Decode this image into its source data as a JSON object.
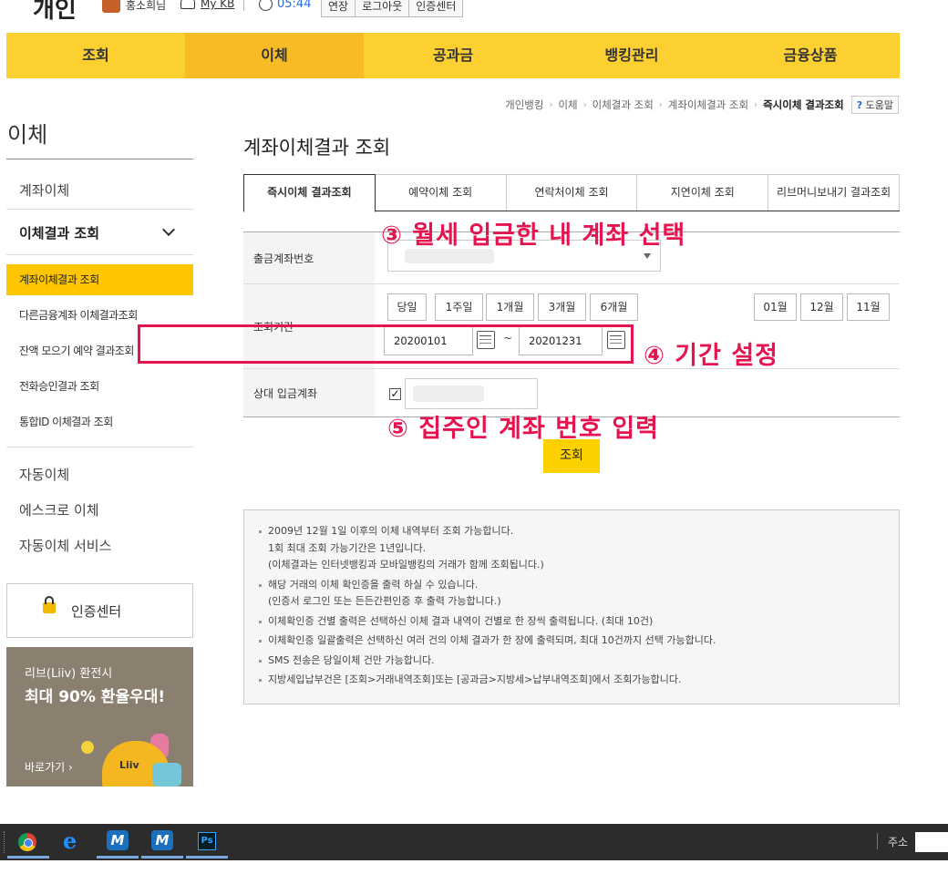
{
  "header": {
    "brand": "개인",
    "user_name": "홍소희님",
    "mykb_label": "My KB",
    "time": "05:44",
    "buttons": [
      "연장",
      "로그아웃",
      "인증센터"
    ]
  },
  "gnb": {
    "items": [
      "조회",
      "이체",
      "공과금",
      "뱅킹관리",
      "금융상품"
    ],
    "active_index": 1
  },
  "breadcrumb": {
    "items": [
      "개인뱅킹",
      "이체",
      "이체결과 조회",
      "계좌이체결과 조회"
    ],
    "current": "즉시이체 결과조회",
    "help_label": "도움말"
  },
  "sidebar": {
    "title": "이체",
    "items": [
      "계좌이체",
      "이체결과 조회",
      "자동이체",
      "에스크로 이체",
      "자동이체 서비스"
    ],
    "sub_items": [
      "계좌이체결과 조회",
      "다른금융계좌 이체결과조회",
      "잔액 모으기 예약 결과조회",
      "전화승인결과 조회",
      "통합ID 이체결과 조회"
    ],
    "cert_label": "인증센터",
    "banner": {
      "line1": "리브(Liiv) 환전시",
      "line2": "최대 90% 환율우대!",
      "link": "바로가기 ›",
      "mascot_text": "Liiv"
    }
  },
  "main": {
    "title": "계좌이체결과 조회",
    "tabs": [
      "즉시이체 결과조회",
      "예약이체 조회",
      "연락처이체 조회",
      "지연이체 조회",
      "리브머니보내기 결과조회"
    ],
    "active_tab": 0,
    "form": {
      "account_label": "출금계좌번호",
      "period_label": "조회기간",
      "period_buttons": [
        "당일",
        "1주일",
        "1개월",
        "3개월",
        "6개월"
      ],
      "month_buttons": [
        "01월",
        "12월",
        "11월"
      ],
      "date_from": "20200101",
      "date_to": "20201231",
      "tilde": "~",
      "counterparty_label": "상대 입금계좌",
      "counterparty_checked": true,
      "search_label": "조회"
    },
    "annotations": {
      "step3": "③ 월세 입금한 내 계좌 선택",
      "step4": "④ 기간 설정",
      "step5": "⑤ 집주인 계좌 번호 입력",
      "color": "#e5134e"
    },
    "notes": [
      "2009년 12월 1일 이후의 이체 내역부터 조회 가능합니다.\n1회 최대 조회 가능기간은 1년입니다.\n(이체결과는 인터넷뱅킹과 모바일뱅킹의 거래가 함께 조회됩니다.)",
      "해당 거래의 이체 확인증을 출력 하실 수 있습니다.\n(인증서 로그인 또는 든든간편인증 후 출력 가능합니다.)",
      "이체확인증 건별 출력은 선택하신 이체 결과 내역이 건별로 한 장씩 출력됩니다. (최대 10건)",
      "이체확인증 일괄출력은 선택하신 여러 건의 이체 결과가 한 장에 출력되며, 최대 10건까지 선택 가능합니다.",
      "SMS 전송은 당일이체 건만 가능합니다.",
      "지방세입납부건은 [조회>거래내역조회]또는 [공과금>지방세>납부내역조회]에서 조회가능합니다."
    ]
  },
  "taskbar": {
    "apps": [
      "chrome-icon",
      "ie-icon",
      "m-app-icon",
      "m-app-icon",
      "photoshop-icon"
    ],
    "ps_label": "Ps",
    "m_label": "M",
    "ie_label": "e",
    "address_label": "주소"
  },
  "colors": {
    "gnb": "#fdd031",
    "gnb_active": "#f7bb23",
    "accent": "#fdc600",
    "annotation": "#e5134e"
  }
}
